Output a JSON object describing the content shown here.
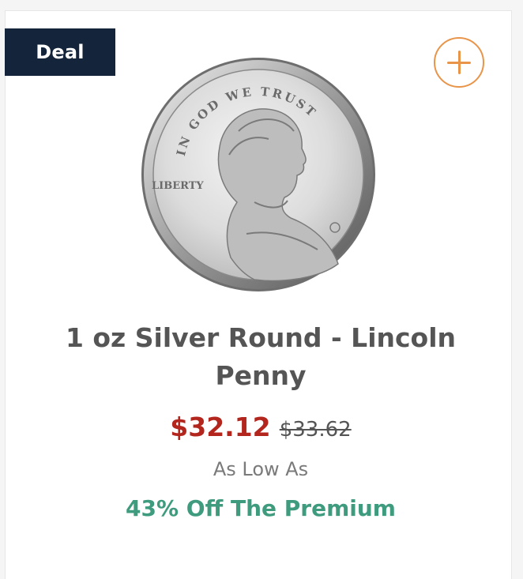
{
  "badge": {
    "label": "Deal",
    "bg_color": "#14243a"
  },
  "add_button": {
    "icon": "plus-circle-icon",
    "color": "#e8954a"
  },
  "product": {
    "image_icon": "lincoln-penny-coin",
    "coin_text_top": "IN GOD WE TRUST",
    "coin_text_left": "LIBERTY",
    "title": "1 oz Silver Round - Lincoln Penny",
    "price_now": "$32.12",
    "price_was": "$33.62",
    "price_note": "As Low As",
    "discount": "43% Off The Premium"
  },
  "colors": {
    "price_now": "#b3261e",
    "discount": "#3e9b7d",
    "text": "#555555"
  }
}
